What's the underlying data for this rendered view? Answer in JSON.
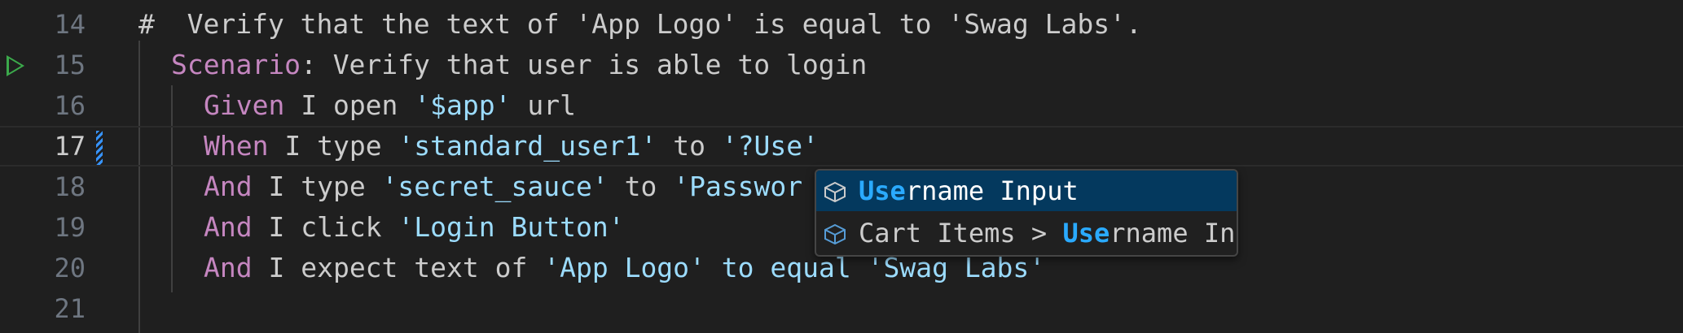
{
  "editor": {
    "lines": [
      {
        "num": "14",
        "tokens": [
          {
            "t": "#  Verify that the text of 'App Logo' is equal to 'Swag Labs'.",
            "c": "plain"
          }
        ]
      },
      {
        "num": "15",
        "tokens": [
          {
            "t": "Scenario",
            "c": "kw"
          },
          {
            "t": ": Verify that user is able to login",
            "c": "plain"
          }
        ]
      },
      {
        "num": "16",
        "tokens": [
          {
            "t": "Given",
            "c": "kw"
          },
          {
            "t": " I open ",
            "c": "plain"
          },
          {
            "t": "'$app'",
            "c": "str"
          },
          {
            "t": " url",
            "c": "plain"
          }
        ]
      },
      {
        "num": "17",
        "tokens": [
          {
            "t": "When",
            "c": "kw"
          },
          {
            "t": " I type ",
            "c": "plain"
          },
          {
            "t": "'standard_user1'",
            "c": "str"
          },
          {
            "t": " to ",
            "c": "plain"
          },
          {
            "t": "'?Use'",
            "c": "str"
          }
        ]
      },
      {
        "num": "18",
        "tokens": [
          {
            "t": "And",
            "c": "kw"
          },
          {
            "t": " I type ",
            "c": "plain"
          },
          {
            "t": "'secret_sauce'",
            "c": "str"
          },
          {
            "t": " to ",
            "c": "plain"
          },
          {
            "t": "'Passwor",
            "c": "str"
          }
        ]
      },
      {
        "num": "19",
        "tokens": [
          {
            "t": "And",
            "c": "kw"
          },
          {
            "t": " I click ",
            "c": "plain"
          },
          {
            "t": "'Login Button'",
            "c": "str"
          }
        ]
      },
      {
        "num": "20",
        "tokens": [
          {
            "t": "And",
            "c": "kw"
          },
          {
            "t": " I expect text of ",
            "c": "plain"
          },
          {
            "t": "'App Logo'",
            "c": "str"
          },
          {
            "t": " to equal ",
            "c": "str"
          },
          {
            "t": "'Swag Labs'",
            "c": "str"
          }
        ]
      },
      {
        "num": "21",
        "tokens": []
      }
    ],
    "active_line": "17",
    "run_line": "15"
  },
  "suggest": {
    "items": [
      {
        "match": "Use",
        "rest_prefix": "",
        "rest": "rname Input",
        "icon": "cube-icon"
      },
      {
        "match": "Use",
        "rest_prefix": "Cart Items > ",
        "rest": "rname Input",
        "icon": "cube-icon"
      }
    ]
  },
  "colors": {
    "keyword": "#c586c0",
    "string": "#9cdcfe",
    "plain": "#cccccc",
    "selection": "#04395e",
    "match": "#2aaaff",
    "run": "#3fb950"
  }
}
